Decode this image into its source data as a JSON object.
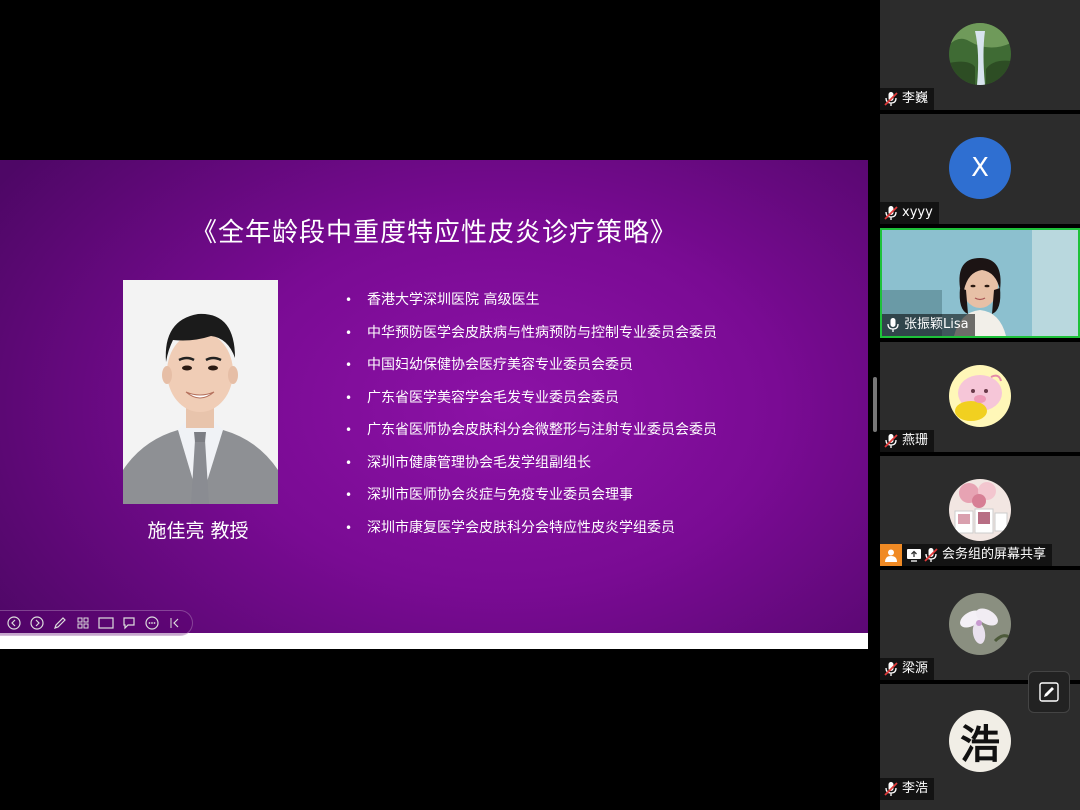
{
  "slide": {
    "title": "《全年龄段中重度特应性皮炎诊疗策略》",
    "speaker": "施佳亮  教授",
    "bullet_symbol": "•",
    "titles": [
      "香港大学深圳医院  高级医生",
      "中华预防医学会皮肤病与性病预防与控制专业委员会委员",
      "中国妇幼保健协会医疗美容专业委员会委员",
      "广东省医学美容学会毛发专业委员会委员",
      "广东省医师协会皮肤科分会微整形与注射专业委员会委员",
      "深圳市健康管理协会毛发学组副组长",
      "深圳市医师协会炎症与免疫专业委员会理事",
      "深圳市康复医学会皮肤科分会特应性皮炎学组委员"
    ]
  },
  "participants": [
    {
      "name": "李巍",
      "mic": "muted",
      "avatar": "waterfall-photo"
    },
    {
      "name": "xyyy",
      "mic": "muted",
      "avatar": "letter",
      "letter": "X",
      "color": "#2f6fd1"
    },
    {
      "name": "张振颖Lisa",
      "mic": "active",
      "avatar": "video",
      "speaking": true
    },
    {
      "name": "燕珊",
      "mic": "muted",
      "avatar": "cartoon-pig"
    },
    {
      "name": "会务组的屏幕共享",
      "mic": "muted",
      "avatar": "flowers-collage",
      "sharing": true
    },
    {
      "name": "梁源",
      "mic": "muted",
      "avatar": "white-flower"
    },
    {
      "name": "李浩",
      "mic": "muted",
      "avatar": "calligraphy",
      "calligraphy_char": "浩"
    }
  ],
  "colors": {
    "slide_purple": "#7a0b94",
    "active_speaker_border": "#1ec23a",
    "muted_mic": "#e03a3a",
    "share_badge": "#f08a24"
  }
}
